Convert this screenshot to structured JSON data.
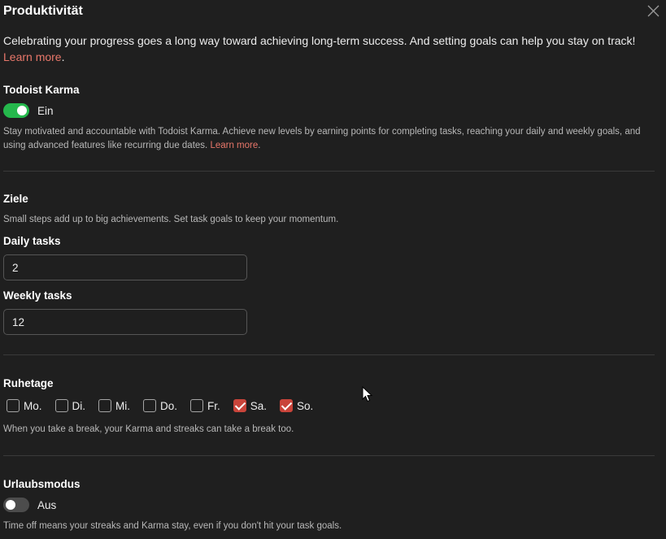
{
  "header": {
    "title": "Produktivität"
  },
  "intro": {
    "text": "Celebrating your progress goes a long way toward achieving long-term success. And setting goals can help you stay on track!",
    "link": "Learn more",
    "link_suffix": "."
  },
  "karma": {
    "heading": "Todoist Karma",
    "toggle_label": "Ein",
    "toggle_state": "on",
    "description": "Stay motivated and accountable with Todoist Karma. Achieve new levels by earning points for completing tasks, reaching your daily and weekly goals, and using advanced features like recurring due dates.",
    "link": "Learn more",
    "link_suffix": "."
  },
  "goals": {
    "heading": "Ziele",
    "description": "Small steps add up to big achievements. Set task goals to keep your momentum.",
    "daily_label": "Daily tasks",
    "daily_value": "2",
    "weekly_label": "Weekly tasks",
    "weekly_value": "12"
  },
  "days_off": {
    "heading": "Ruhetage",
    "days": [
      {
        "label": "Mo.",
        "checked": false
      },
      {
        "label": "Di.",
        "checked": false
      },
      {
        "label": "Mi.",
        "checked": false
      },
      {
        "label": "Do.",
        "checked": false
      },
      {
        "label": "Fr.",
        "checked": false
      },
      {
        "label": "Sa.",
        "checked": true
      },
      {
        "label": "So.",
        "checked": true
      }
    ],
    "description": "When you take a break, your Karma and streaks can take a break too."
  },
  "vacation": {
    "heading": "Urlaubsmodus",
    "toggle_label": "Aus",
    "toggle_state": "off",
    "description": "Time off means your streaks and Karma stay, even if you don't hit your task goals."
  },
  "colors": {
    "background": "#1f1f1f",
    "link": "#e8776a",
    "toggle_on": "#25b84c",
    "checkbox_checked": "#c9443a"
  },
  "icons": {
    "close": "close-icon",
    "cursor": "mouse-pointer-icon"
  }
}
